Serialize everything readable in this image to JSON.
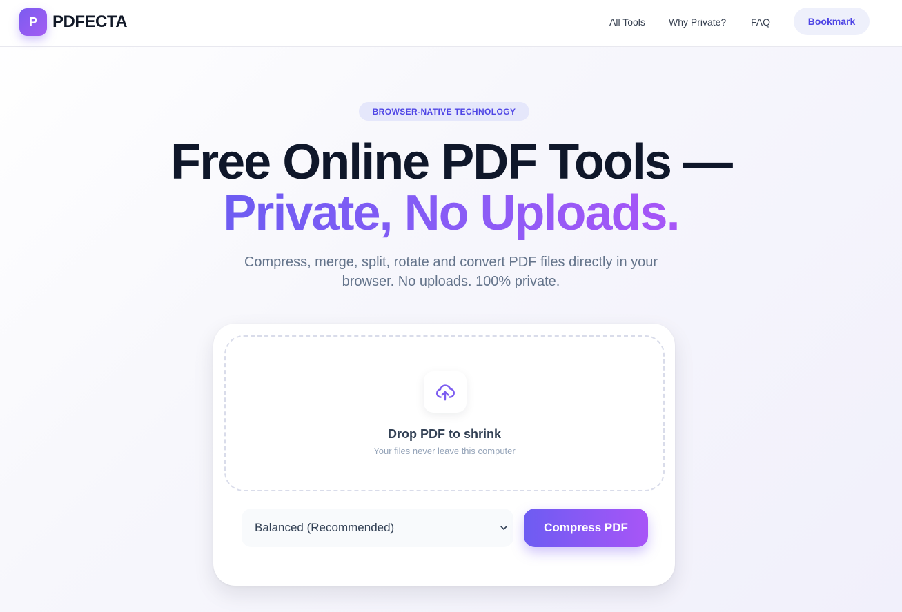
{
  "header": {
    "logo_letter": "P",
    "brand": "PDFECTA",
    "nav": [
      "All Tools",
      "Why Private?",
      "FAQ"
    ],
    "bookmark_label": "Bookmark"
  },
  "hero": {
    "badge": "BROWSER-NATIVE TECHNOLOGY",
    "title_line1": "Free Online PDF Tools —",
    "title_line2": "Private, No Uploads.",
    "subtitle": "Compress, merge, split, rotate and convert PDF files directly in your browser. No uploads. 100% private."
  },
  "tool": {
    "icon": "cloud-upload-icon",
    "drop_title": "Drop PDF to shrink",
    "drop_subtitle": "Your files never leave this computer",
    "compression_level": "Balanced (Recommended)",
    "action_label": "Compress PDF"
  },
  "colors": {
    "accent": "#6d5cf2",
    "accent_end": "#a855f7",
    "brand_text": "#111827"
  }
}
